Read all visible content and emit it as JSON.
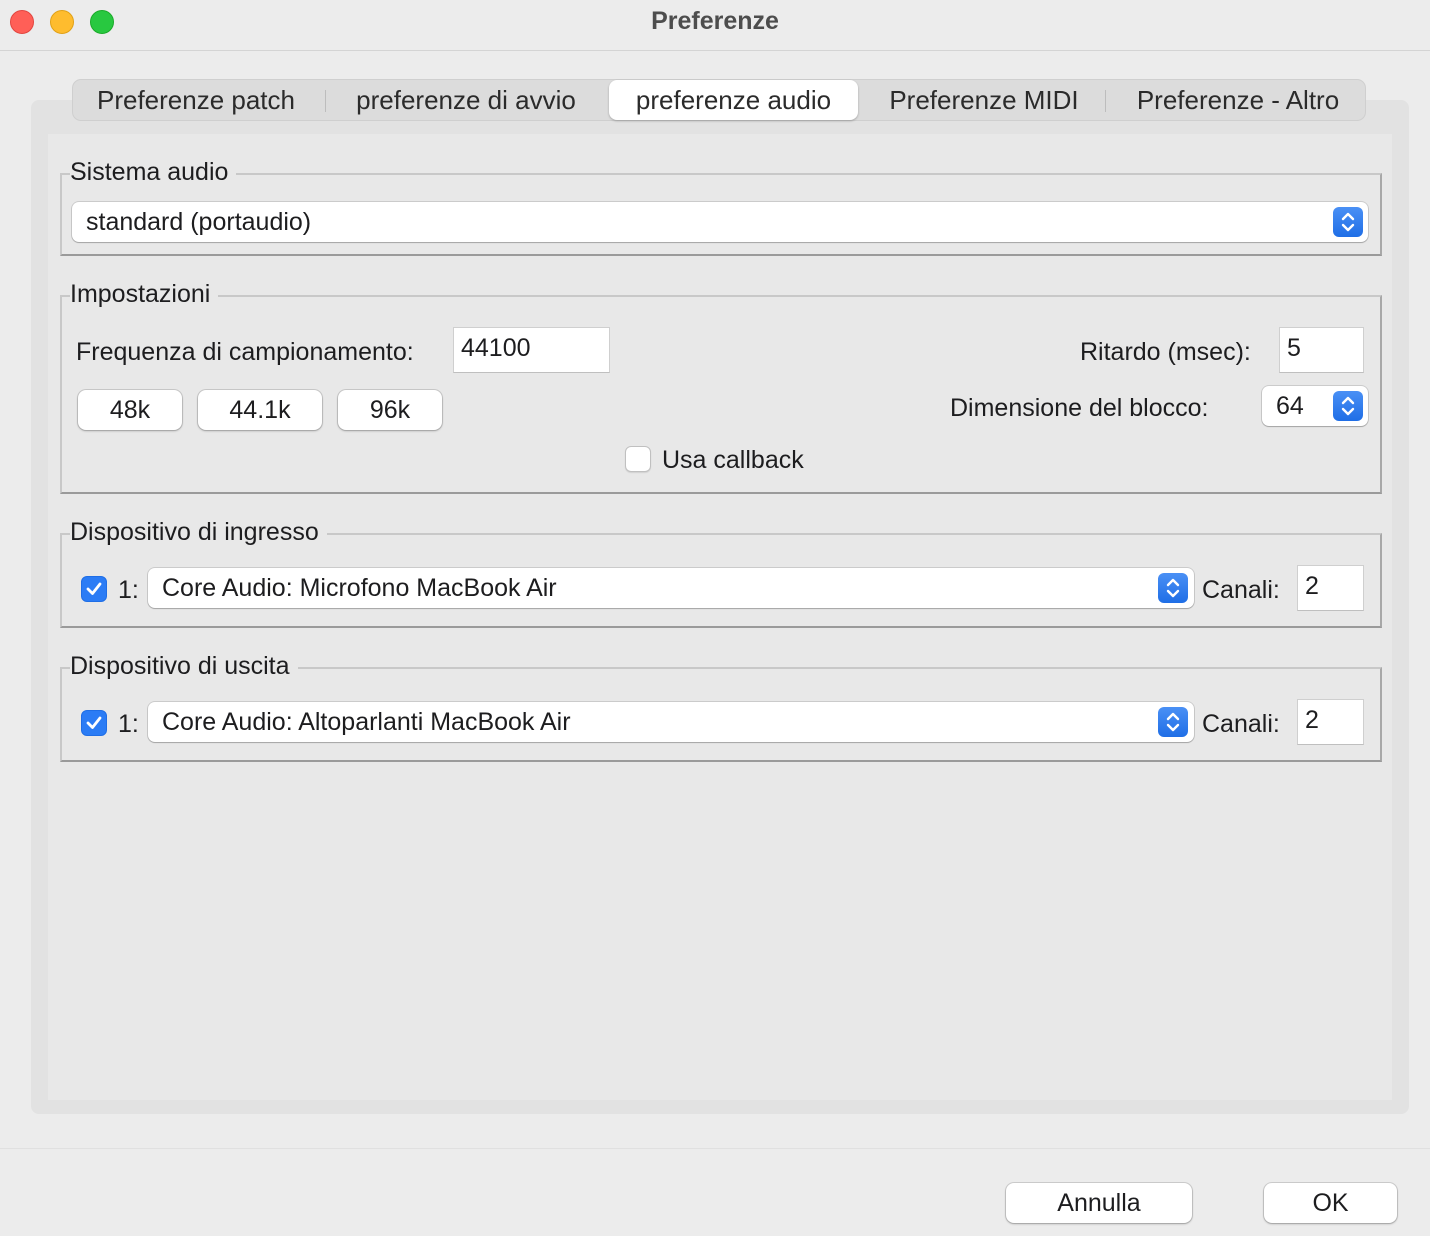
{
  "window": {
    "title": "Preferenze"
  },
  "tabs": [
    {
      "label": "Preferenze patch",
      "active": false
    },
    {
      "label": "preferenze di avvio",
      "active": false
    },
    {
      "label": "preferenze audio",
      "active": true
    },
    {
      "label": "Preferenze MIDI",
      "active": false
    },
    {
      "label": "Preferenze - Altro",
      "active": false
    }
  ],
  "audio_system": {
    "title": "Sistema audio",
    "selected": "standard (portaudio)"
  },
  "settings": {
    "title": "Impostazioni",
    "sample_rate_label": "Frequenza di campionamento:",
    "sample_rate_value": "44100",
    "rate_buttons": [
      "48k",
      "44.1k",
      "96k"
    ],
    "delay_label": "Ritardo (msec):",
    "delay_value": "5",
    "block_size_label": "Dimensione del blocco:",
    "block_size_value": "64",
    "callback_label": "Usa callback",
    "callback_checked": false
  },
  "input_device": {
    "title": "Dispositivo di ingresso",
    "enabled": true,
    "index": "1:",
    "device": "Core Audio: Microfono MacBook Air",
    "channels_label": "Canali:",
    "channels_value": "2"
  },
  "output_device": {
    "title": "Dispositivo di uscita",
    "enabled": true,
    "index": "1:",
    "device": "Core Audio: Altoparlanti MacBook Air",
    "channels_label": "Canali:",
    "channels_value": "2"
  },
  "footer": {
    "cancel_label": "Annulla",
    "ok_label": "OK"
  },
  "colors": {
    "accent": "#2b7cf5",
    "close": "#ff5f57",
    "minimize": "#febc2e",
    "maximize": "#28c840"
  }
}
